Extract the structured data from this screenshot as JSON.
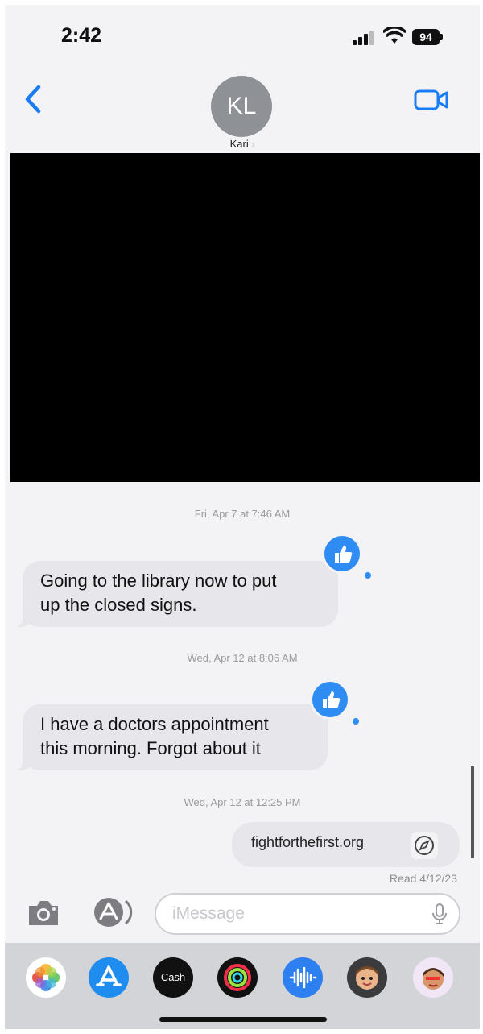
{
  "status_bar": {
    "time": "2:42",
    "battery": "94"
  },
  "header": {
    "avatar_initials": "KL",
    "contact_name": "Kari",
    "name_chevron": "›"
  },
  "messages": [
    {
      "timestamp": "Fri, Apr 7 at 7:46 AM",
      "direction": "incoming",
      "lines": [
        "Going to the library now to put",
        "up the closed signs."
      ],
      "tapback": "thumbs-up"
    },
    {
      "timestamp": "Wed, Apr 12 at 8:06 AM",
      "direction": "incoming",
      "lines": [
        "I have a doctors appointment",
        "this morning. Forgot about it"
      ],
      "tapback": "thumbs-up"
    },
    {
      "timestamp": "Wed, Apr 12 at 12:25 PM",
      "direction": "outgoing",
      "link_text": "fightforthefirst.org",
      "receipt": "Read 4/12/23"
    }
  ],
  "composer": {
    "placeholder": "iMessage"
  },
  "app_drawer": {
    "apps": [
      "photos-icon",
      "app-store-icon",
      "apple-cash-icon",
      "activity-icon",
      "audio-message-icon",
      "memoji-icon",
      "memoji-stickers-icon"
    ],
    "cash_label": "Cash"
  },
  "colors": {
    "accent": "#2f8cf3",
    "bubble_gray": "#e6e6eb",
    "background": "#f3f3f5"
  }
}
